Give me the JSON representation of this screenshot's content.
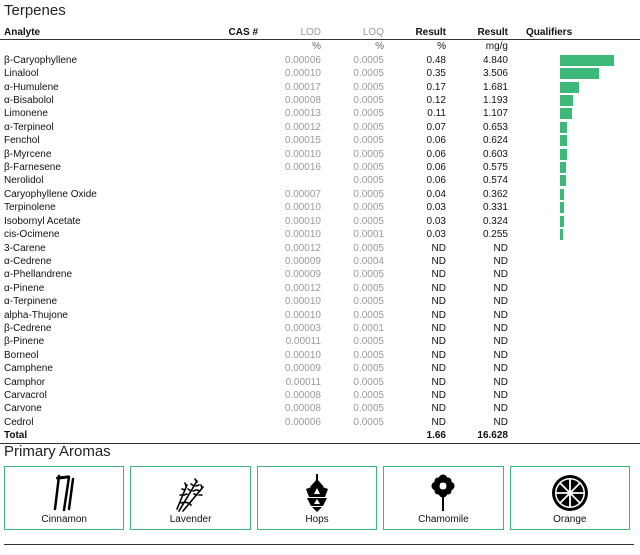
{
  "section_title": "Terpenes",
  "columns": {
    "analyte": "Analyte",
    "cas": "CAS #",
    "lod": "LOD",
    "loq": "LOQ",
    "result_pct": "Result",
    "result_mgg": "Result",
    "qualifiers": "Qualifiers"
  },
  "units": {
    "lod": "%",
    "loq": "%",
    "result_pct": "%",
    "result_mgg": "mg/g"
  },
  "rows": [
    {
      "analyte": "β-Caryophyllene",
      "lod": "0.00006",
      "loq": "0.0005",
      "pct": "0.48",
      "mgg": "4.840",
      "bar": 4.84
    },
    {
      "analyte": "Linalool",
      "lod": "0.00010",
      "loq": "0.0005",
      "pct": "0.35",
      "mgg": "3.506",
      "bar": 3.506
    },
    {
      "analyte": "α-Humulene",
      "lod": "0.00017",
      "loq": "0.0005",
      "pct": "0.17",
      "mgg": "1.681",
      "bar": 1.681
    },
    {
      "analyte": "α-Bisabolol",
      "lod": "0.00008",
      "loq": "0.0005",
      "pct": "0.12",
      "mgg": "1.193",
      "bar": 1.193
    },
    {
      "analyte": "Limonene",
      "lod": "0.00013",
      "loq": "0.0005",
      "pct": "0.11",
      "mgg": "1.107",
      "bar": 1.107
    },
    {
      "analyte": "α-Terpineol",
      "lod": "0.00012",
      "loq": "0.0005",
      "pct": "0.07",
      "mgg": "0.653",
      "bar": 0.653
    },
    {
      "analyte": "Fenchol",
      "lod": "0.00015",
      "loq": "0.0005",
      "pct": "0.06",
      "mgg": "0.624",
      "bar": 0.624
    },
    {
      "analyte": "β-Myrcene",
      "lod": "0.00010",
      "loq": "0.0005",
      "pct": "0.06",
      "mgg": "0.603",
      "bar": 0.603
    },
    {
      "analyte": "β-Farnesene",
      "lod": "0.00016",
      "loq": "0.0005",
      "pct": "0.06",
      "mgg": "0.575",
      "bar": 0.575
    },
    {
      "analyte": "Nerolidol",
      "lod": "",
      "loq": "0.0005",
      "pct": "0.06",
      "mgg": "0.574",
      "bar": 0.574
    },
    {
      "analyte": "Caryophyllene Oxide",
      "lod": "0.00007",
      "loq": "0.0005",
      "pct": "0.04",
      "mgg": "0.362",
      "bar": 0.362
    },
    {
      "analyte": "Terpinolene",
      "lod": "0.00010",
      "loq": "0.0005",
      "pct": "0.03",
      "mgg": "0.331",
      "bar": 0.331
    },
    {
      "analyte": "Isobornyl Acetate",
      "lod": "0.00010",
      "loq": "0.0005",
      "pct": "0.03",
      "mgg": "0.324",
      "bar": 0.324
    },
    {
      "analyte": "cis-Ocimene",
      "lod": "0.00010",
      "loq": "0.0001",
      "pct": "0.03",
      "mgg": "0.255",
      "bar": 0.255
    },
    {
      "analyte": "3-Carene",
      "lod": "0.00012",
      "loq": "0.0005",
      "pct": "ND",
      "mgg": "ND",
      "bar": 0
    },
    {
      "analyte": "α-Cedrene",
      "lod": "0.00009",
      "loq": "0.0004",
      "pct": "ND",
      "mgg": "ND",
      "bar": 0
    },
    {
      "analyte": "α-Phellandrene",
      "lod": "0.00009",
      "loq": "0.0005",
      "pct": "ND",
      "mgg": "ND",
      "bar": 0
    },
    {
      "analyte": "α-Pinene",
      "lod": "0.00012",
      "loq": "0.0005",
      "pct": "ND",
      "mgg": "ND",
      "bar": 0
    },
    {
      "analyte": "α-Terpinene",
      "lod": "0.00010",
      "loq": "0.0005",
      "pct": "ND",
      "mgg": "ND",
      "bar": 0
    },
    {
      "analyte": "alpha-Thujone",
      "lod": "0.00010",
      "loq": "0.0005",
      "pct": "ND",
      "mgg": "ND",
      "bar": 0
    },
    {
      "analyte": "β-Cedrene",
      "lod": "0.00003",
      "loq": "0.0001",
      "pct": "ND",
      "mgg": "ND",
      "bar": 0
    },
    {
      "analyte": "β-Pinene",
      "lod": "0.00011",
      "loq": "0.0005",
      "pct": "ND",
      "mgg": "ND",
      "bar": 0
    },
    {
      "analyte": "Borneol",
      "lod": "0.00010",
      "loq": "0.0005",
      "pct": "ND",
      "mgg": "ND",
      "bar": 0
    },
    {
      "analyte": "Camphene",
      "lod": "0.00009",
      "loq": "0.0005",
      "pct": "ND",
      "mgg": "ND",
      "bar": 0
    },
    {
      "analyte": "Camphor",
      "lod": "0.00011",
      "loq": "0.0005",
      "pct": "ND",
      "mgg": "ND",
      "bar": 0
    },
    {
      "analyte": "Carvacrol",
      "lod": "0.00008",
      "loq": "0.0005",
      "pct": "ND",
      "mgg": "ND",
      "bar": 0
    },
    {
      "analyte": "Carvone",
      "lod": "0.00008",
      "loq": "0.0005",
      "pct": "ND",
      "mgg": "ND",
      "bar": 0
    },
    {
      "analyte": "Cedrol",
      "lod": "0.00006",
      "loq": "0.0005",
      "pct": "ND",
      "mgg": "ND",
      "bar": 0
    }
  ],
  "total": {
    "label": "Total",
    "pct": "1.66",
    "mgg": "16.628"
  },
  "bar_max": 4.84,
  "bar_color": "#3cb878",
  "aromas_title": "Primary Aromas",
  "aromas": [
    {
      "label": "Cinnamon",
      "icon": "cinnamon-icon"
    },
    {
      "label": "Lavender",
      "icon": "lavender-icon"
    },
    {
      "label": "Hops",
      "icon": "hops-icon"
    },
    {
      "label": "Chamomile",
      "icon": "chamomile-icon"
    },
    {
      "label": "Orange",
      "icon": "orange-icon"
    }
  ]
}
